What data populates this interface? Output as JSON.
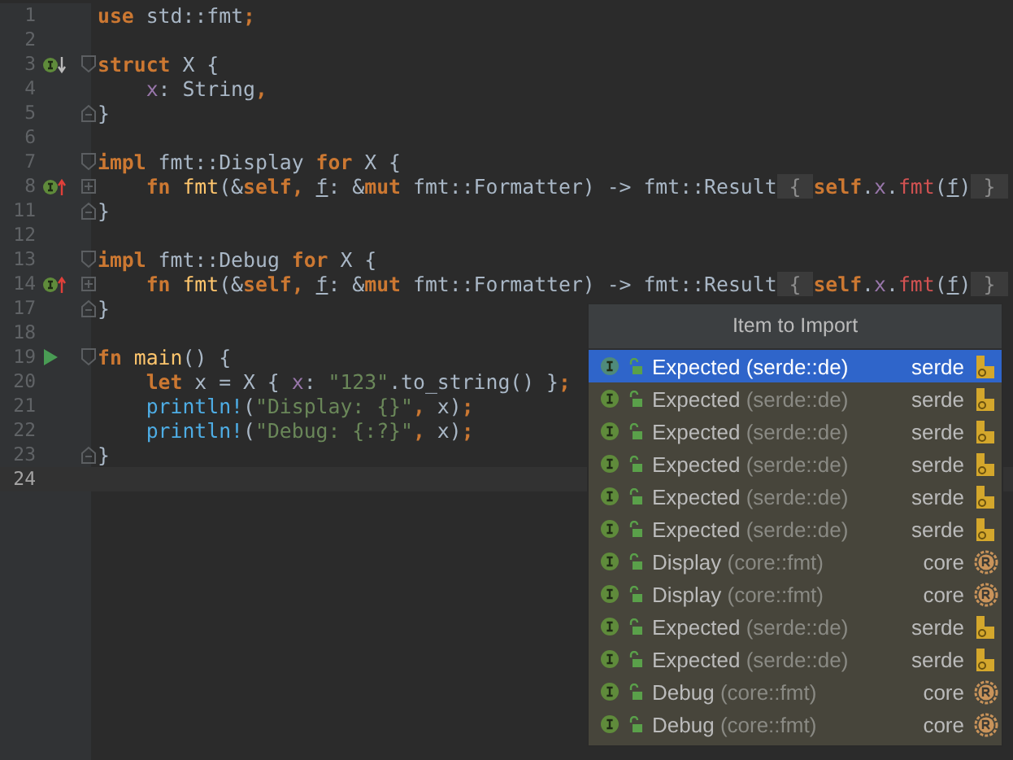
{
  "editor": {
    "lines": [
      {
        "number": "1",
        "current": false,
        "indent": false,
        "tokens": [
          {
            "kind": "keyword",
            "text": "use"
          },
          {
            "kind": "plain",
            "text": " std::fmt"
          },
          {
            "kind": "keyword",
            "text": ";"
          }
        ]
      },
      {
        "number": "2",
        "current": false
      },
      {
        "number": "3",
        "current": false,
        "indent": false,
        "gutter_icon": {
          "kind": "implemented"
        },
        "fold": {
          "kind": "start"
        },
        "tokens": [
          {
            "kind": "keyword",
            "text": "struct"
          },
          {
            "kind": "plain",
            "text": " X {"
          }
        ]
      },
      {
        "number": "4",
        "current": false,
        "indent": true,
        "tokens": [
          {
            "kind": "field",
            "text": "x"
          },
          {
            "kind": "plain",
            "text": ": String"
          },
          {
            "kind": "keyword",
            "text": ","
          }
        ]
      },
      {
        "number": "5",
        "current": false,
        "indent": false,
        "fold": {
          "kind": "end"
        },
        "tokens": [
          {
            "kind": "plain",
            "text": "}"
          }
        ]
      },
      {
        "number": "6",
        "current": false
      },
      {
        "number": "7",
        "current": false,
        "indent": false,
        "fold": {
          "kind": "start"
        },
        "tokens": [
          {
            "kind": "keyword",
            "text": "impl"
          },
          {
            "kind": "plain",
            "text": " fmt::Display "
          },
          {
            "kind": "keyword",
            "text": "for"
          },
          {
            "kind": "plain",
            "text": " X {"
          }
        ]
      },
      {
        "number": "8",
        "current": false,
        "indent": true,
        "gutter_icon": {
          "kind": "implementing"
        },
        "fold": {
          "kind": "collapsed"
        },
        "tokens": [
          {
            "kind": "keyword",
            "text": "fn"
          },
          {
            "kind": "function",
            "text": " fmt"
          },
          {
            "kind": "plain",
            "text": "(&"
          },
          {
            "kind": "keyword",
            "text": "self"
          },
          {
            "kind": "keyword",
            "text": ", "
          },
          {
            "kind": "param",
            "text": "f"
          },
          {
            "kind": "plain",
            "text": ": &"
          },
          {
            "kind": "keyword",
            "text": "mut"
          },
          {
            "kind": "plain",
            "text": " fmt::Formatter) -> fmt::Result"
          },
          {
            "kind": "folded",
            "text": " { "
          },
          {
            "kind": "keyword",
            "text": "self"
          },
          {
            "kind": "plain",
            "text": "."
          },
          {
            "kind": "field",
            "text": "x"
          },
          {
            "kind": "plain",
            "text": "."
          },
          {
            "kind": "call",
            "text": "fmt"
          },
          {
            "kind": "plain",
            "text": "("
          },
          {
            "kind": "param",
            "text": "f"
          },
          {
            "kind": "plain",
            "text": ")"
          },
          {
            "kind": "folded",
            "text": " } "
          }
        ]
      },
      {
        "number": "11",
        "current": false,
        "indent": false,
        "fold": {
          "kind": "end"
        },
        "tokens": [
          {
            "kind": "plain",
            "text": "}"
          }
        ]
      },
      {
        "number": "12",
        "current": false
      },
      {
        "number": "13",
        "current": false,
        "indent": false,
        "fold": {
          "kind": "start"
        },
        "tokens": [
          {
            "kind": "keyword",
            "text": "impl"
          },
          {
            "kind": "plain",
            "text": " fmt::Debug "
          },
          {
            "kind": "keyword",
            "text": "for"
          },
          {
            "kind": "plain",
            "text": " X {"
          }
        ]
      },
      {
        "number": "14",
        "current": false,
        "indent": true,
        "gutter_icon": {
          "kind": "implementing"
        },
        "fold": {
          "kind": "collapsed"
        },
        "tokens": [
          {
            "kind": "keyword",
            "text": "fn"
          },
          {
            "kind": "function",
            "text": " fmt"
          },
          {
            "kind": "plain",
            "text": "(&"
          },
          {
            "kind": "keyword",
            "text": "self"
          },
          {
            "kind": "keyword",
            "text": ", "
          },
          {
            "kind": "param",
            "text": "f"
          },
          {
            "kind": "plain",
            "text": ": &"
          },
          {
            "kind": "keyword",
            "text": "mut"
          },
          {
            "kind": "plain",
            "text": " fmt::Formatter) -> fmt::Result"
          },
          {
            "kind": "folded",
            "text": " { "
          },
          {
            "kind": "keyword",
            "text": "self"
          },
          {
            "kind": "plain",
            "text": "."
          },
          {
            "kind": "field",
            "text": "x"
          },
          {
            "kind": "plain",
            "text": "."
          },
          {
            "kind": "call",
            "text": "fmt"
          },
          {
            "kind": "plain",
            "text": "("
          },
          {
            "kind": "param",
            "text": "f"
          },
          {
            "kind": "plain",
            "text": ")"
          },
          {
            "kind": "folded",
            "text": " } "
          }
        ]
      },
      {
        "number": "17",
        "current": false,
        "indent": false,
        "fold": {
          "kind": "end"
        },
        "tokens": [
          {
            "kind": "plain",
            "text": "}"
          }
        ]
      },
      {
        "number": "18",
        "current": false
      },
      {
        "number": "19",
        "current": false,
        "indent": false,
        "gutter_icon": {
          "kind": "run"
        },
        "fold": {
          "kind": "start"
        },
        "tokens": [
          {
            "kind": "keyword",
            "text": "fn"
          },
          {
            "kind": "function",
            "text": " main"
          },
          {
            "kind": "plain",
            "text": "() {"
          }
        ]
      },
      {
        "number": "20",
        "current": false,
        "indent": true,
        "tokens": [
          {
            "kind": "keyword",
            "text": "let"
          },
          {
            "kind": "plain",
            "text": " x = X { "
          },
          {
            "kind": "field",
            "text": "x"
          },
          {
            "kind": "plain",
            "text": ": "
          },
          {
            "kind": "string",
            "text": "\"123\""
          },
          {
            "kind": "plain",
            "text": ".to_string() }"
          },
          {
            "kind": "keyword",
            "text": ";"
          }
        ]
      },
      {
        "number": "21",
        "current": false,
        "indent": true,
        "tokens": [
          {
            "kind": "macro",
            "text": "println!"
          },
          {
            "kind": "plain",
            "text": "("
          },
          {
            "kind": "string",
            "text": "\"Display: {}\""
          },
          {
            "kind": "keyword",
            "text": ","
          },
          {
            "kind": "plain",
            "text": " x)"
          },
          {
            "kind": "keyword",
            "text": ";"
          }
        ]
      },
      {
        "number": "22",
        "current": false,
        "indent": true,
        "tokens": [
          {
            "kind": "macro",
            "text": "println!"
          },
          {
            "kind": "plain",
            "text": "("
          },
          {
            "kind": "string",
            "text": "\"Debug: {:?}\""
          },
          {
            "kind": "keyword",
            "text": ","
          },
          {
            "kind": "plain",
            "text": " x)"
          },
          {
            "kind": "keyword",
            "text": ";"
          }
        ]
      },
      {
        "number": "23",
        "current": false,
        "indent": false,
        "fold": {
          "kind": "end"
        },
        "tokens": [
          {
            "kind": "plain",
            "text": "}"
          }
        ]
      },
      {
        "number": "24",
        "current": true
      }
    ]
  },
  "popup": {
    "title": "Item to Import",
    "items": [
      {
        "name": "Expected",
        "path": "(serde::de)",
        "crate": "serde",
        "kind": "crate",
        "selected": true
      },
      {
        "name": "Expected",
        "path": "(serde::de)",
        "crate": "serde",
        "kind": "crate",
        "selected": false
      },
      {
        "name": "Expected",
        "path": "(serde::de)",
        "crate": "serde",
        "kind": "crate",
        "selected": false
      },
      {
        "name": "Expected",
        "path": "(serde::de)",
        "crate": "serde",
        "kind": "crate",
        "selected": false
      },
      {
        "name": "Expected",
        "path": "(serde::de)",
        "crate": "serde",
        "kind": "crate",
        "selected": false
      },
      {
        "name": "Expected",
        "path": "(serde::de)",
        "crate": "serde",
        "kind": "crate",
        "selected": false
      },
      {
        "name": "Display",
        "path": "(core::fmt)",
        "crate": "core",
        "kind": "rust",
        "selected": false
      },
      {
        "name": "Display",
        "path": "(core::fmt)",
        "crate": "core",
        "kind": "rust",
        "selected": false
      },
      {
        "name": "Expected",
        "path": "(serde::de)",
        "crate": "serde",
        "kind": "crate",
        "selected": false
      },
      {
        "name": "Expected",
        "path": "(serde::de)",
        "crate": "serde",
        "kind": "crate",
        "selected": false
      },
      {
        "name": "Debug",
        "path": "(core::fmt)",
        "crate": "core",
        "kind": "rust",
        "selected": false
      },
      {
        "name": "Debug",
        "path": "(core::fmt)",
        "crate": "core",
        "kind": "rust",
        "selected": false
      }
    ]
  }
}
